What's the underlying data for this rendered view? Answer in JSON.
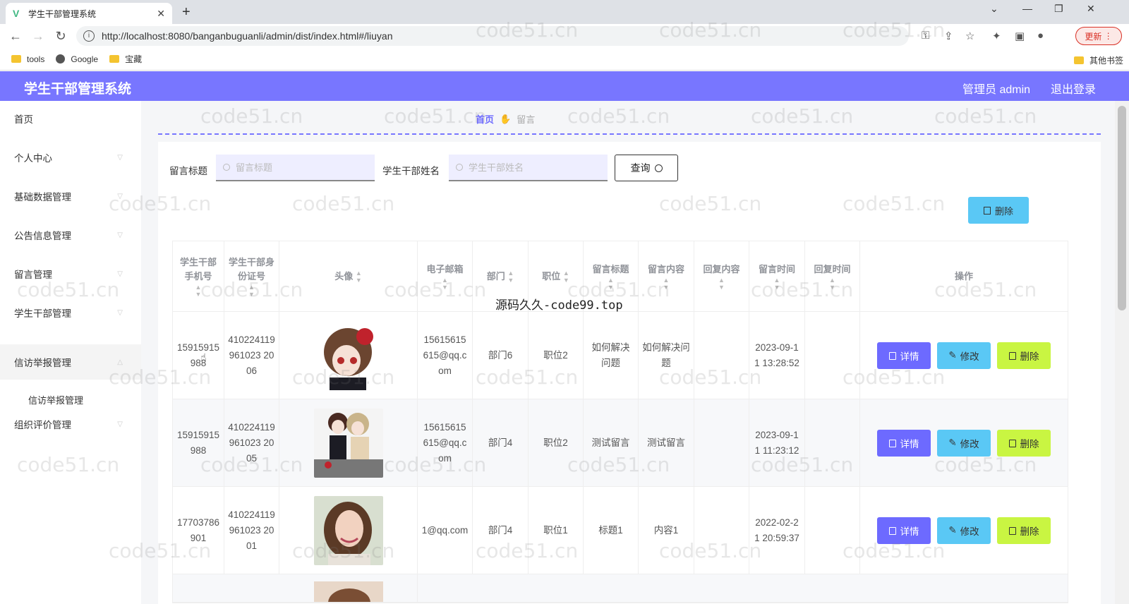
{
  "browser": {
    "tab_title": "学生干部管理系统",
    "url": "http://localhost:8080/banganbuguanli/admin/dist/index.html#/liuyan",
    "update_label": "更新",
    "bookmarks": [
      "tools",
      "Google",
      "宝藏"
    ],
    "other_bookmarks": "其他书签"
  },
  "header": {
    "title": "学生干部管理系统",
    "admin_label": "管理员 admin",
    "logout_label": "退出登录"
  },
  "sidebar": {
    "items": [
      "首页",
      "个人中心",
      "基础数据管理",
      "公告信息管理",
      "留言管理",
      "学生干部管理",
      "信访举报管理",
      "组织评价管理"
    ],
    "submenu": "信访举报管理"
  },
  "breadcrumb": {
    "home": "首页",
    "current": "留言"
  },
  "search": {
    "title_label": "留言标题",
    "title_placeholder": "留言标题",
    "name_label": "学生干部姓名",
    "name_placeholder": "学生干部姓名",
    "query_label": "查询",
    "delete_label": "删除"
  },
  "table": {
    "columns": [
      "学生干部手机号",
      "学生干部身份证号",
      "头像",
      "电子邮箱",
      "部门",
      "职位",
      "留言标题",
      "留言内容",
      "回复内容",
      "留言时间",
      "回复时间",
      "操作"
    ],
    "rows": [
      {
        "phone": "15915915988",
        "idcard": "410224119961023 2006",
        "email": "15615615615@qq.com",
        "dept": "部门6",
        "position": "职位2",
        "title": "如何解决问题",
        "content": "如何解决问题",
        "reply": "",
        "time": "2023-09-11 13:28:52",
        "reply_time": ""
      },
      {
        "phone": "15915915988",
        "idcard": "410224119961023 2005",
        "email": "15615615615@qq.com",
        "dept": "部门4",
        "position": "职位2",
        "title": "测试留言",
        "content": "测试留言",
        "reply": "",
        "time": "2023-09-11 11:23:12",
        "reply_time": ""
      },
      {
        "phone": "17703786901",
        "idcard": "410224119961023 2001",
        "email": "1@qq.com",
        "dept": "部门4",
        "position": "职位1",
        "title": "标题1",
        "content": "内容1",
        "reply": "",
        "time": "2022-02-21 20:59:37",
        "reply_time": ""
      }
    ],
    "actions": {
      "detail": "详情",
      "edit": "修改",
      "delete": "删除"
    }
  },
  "watermark": "code51.cn",
  "watermark_center": "源码久久-code99.top"
}
